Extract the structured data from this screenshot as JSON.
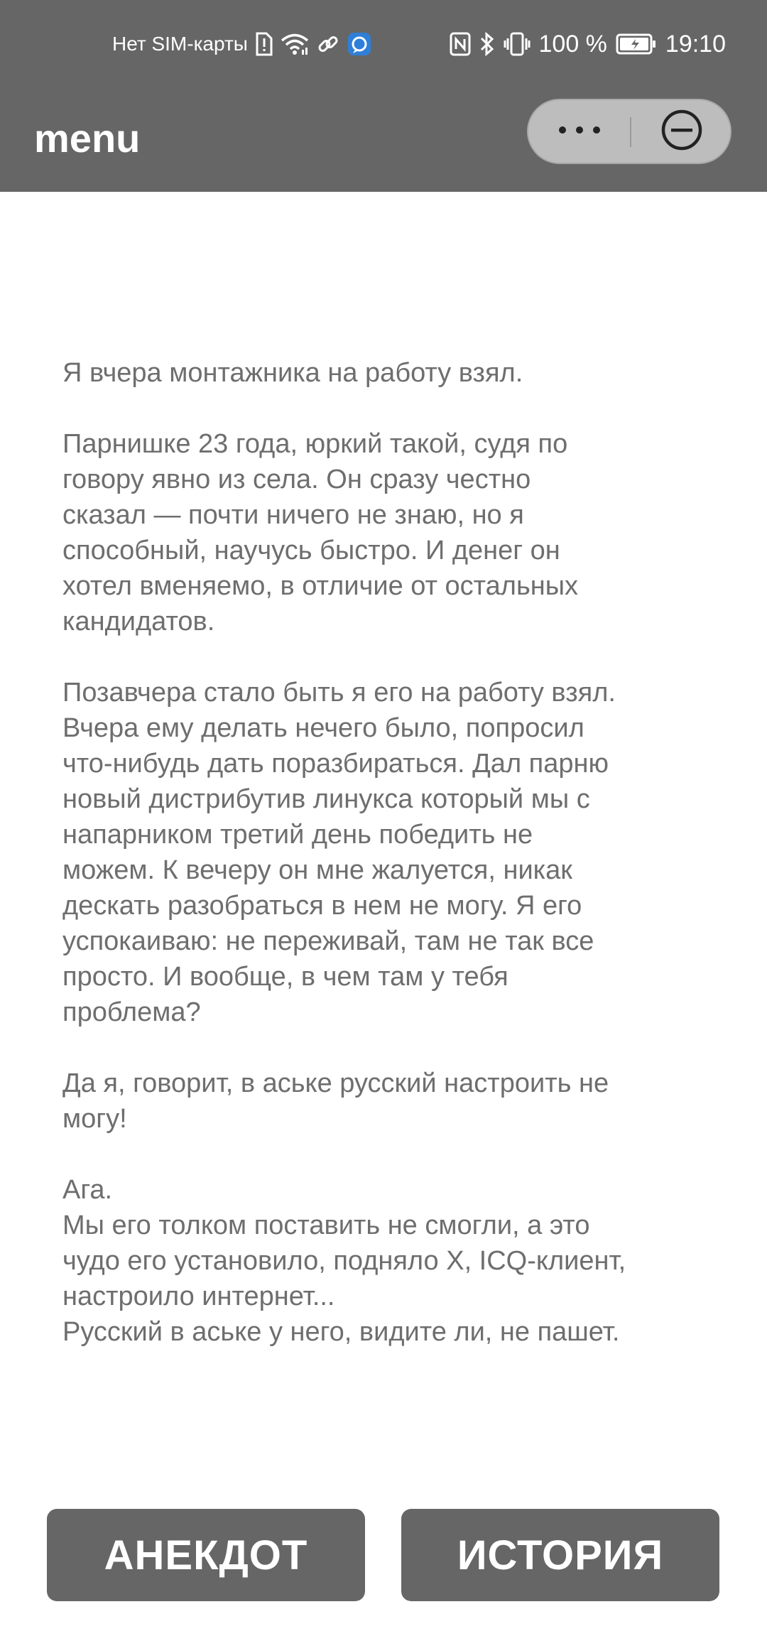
{
  "status_bar": {
    "sim_text": "Нет SIM-карты",
    "battery_percent": "100 %",
    "time": "19:10",
    "icons_left": [
      "sim-alert-icon",
      "wifi-icon",
      "link-icon",
      "app-notification-icon"
    ],
    "icons_right": [
      "nfc-icon",
      "bluetooth-icon",
      "vibrate-icon",
      "battery-icon"
    ]
  },
  "app_bar": {
    "title": "menu",
    "more_icon": "more-dots-icon",
    "close_icon": "minus-circle-icon"
  },
  "content": {
    "text": "Я вчера монтажника на работу взял.\n\nПарнишке 23 года, юркий такой, судя по\nговору явно из села. Он сразу честно\nсказал — почти ничего не знаю, но я\nспособный, научусь быстро. И денег он\nхотел вменяемо, в отличие от остальных\nкандидатов.\n\nПозавчера стало быть я его на работу взял.\nВчера ему делать нечего было, попросил\nчто-нибудь дать поразбираться. Дал парню\nновый дистрибутив линукса который мы с\nнапарником третий день победить не\nможем. К вечеру он мне жалуется, никак\nдескать разобраться в нем не могу. Я его\nуспокаиваю: не переживай, там не так все\nпросто. И вообще, в чем там у тебя\nпроблема?\n\nДа я, говорит, в аське русский настроить не\nмогу!\n\nАга.\nМы его толком поставить не смогли, а это\nчудо его установило, подняло X, ICQ-клиент,\nнастроило интернет...\nРусский в аське у него, видите ли, не пашет."
  },
  "buttons": {
    "joke": "АНЕКДОТ",
    "story": "ИСТОРИЯ"
  },
  "colors": {
    "bar": "#666666",
    "text": "#6e6e6e",
    "capsule": "#bdbdbd",
    "button": "#666666"
  }
}
